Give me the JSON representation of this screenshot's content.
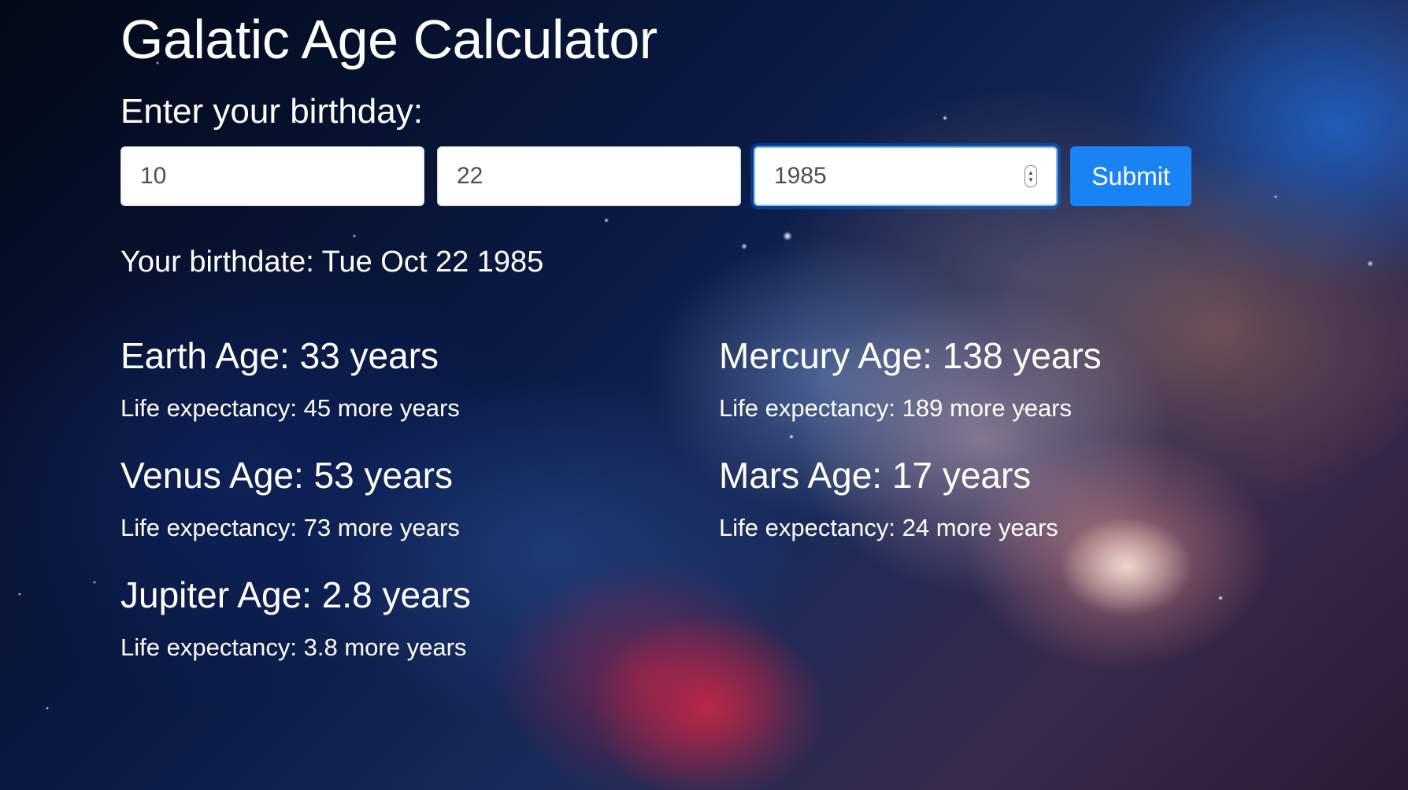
{
  "app": {
    "title": "Galatic Age Calculator",
    "prompt": "Enter your birthday:"
  },
  "form": {
    "month": "10",
    "day": "22",
    "year": "1985",
    "submit_label": "Submit"
  },
  "result": {
    "birthdate": "Your birthdate: Tue Oct 22 1985"
  },
  "planets": {
    "earth": {
      "age": "Earth Age: 33 years",
      "life": "Life expectancy: 45 more years"
    },
    "mercury": {
      "age": "Mercury Age: 138 years",
      "life": "Life expectancy: 189 more years"
    },
    "venus": {
      "age": "Venus Age: 53 years",
      "life": "Life expectancy: 73 more years"
    },
    "mars": {
      "age": "Mars Age: 17 years",
      "life": "Life expectancy: 24 more years"
    },
    "jupiter": {
      "age": "Jupiter Age: 2.8 years",
      "life": "Life expectancy: 3.8 more years"
    }
  },
  "colors": {
    "accent": "#1a84f7",
    "text": "#ffffff",
    "input_text": "#495057"
  }
}
